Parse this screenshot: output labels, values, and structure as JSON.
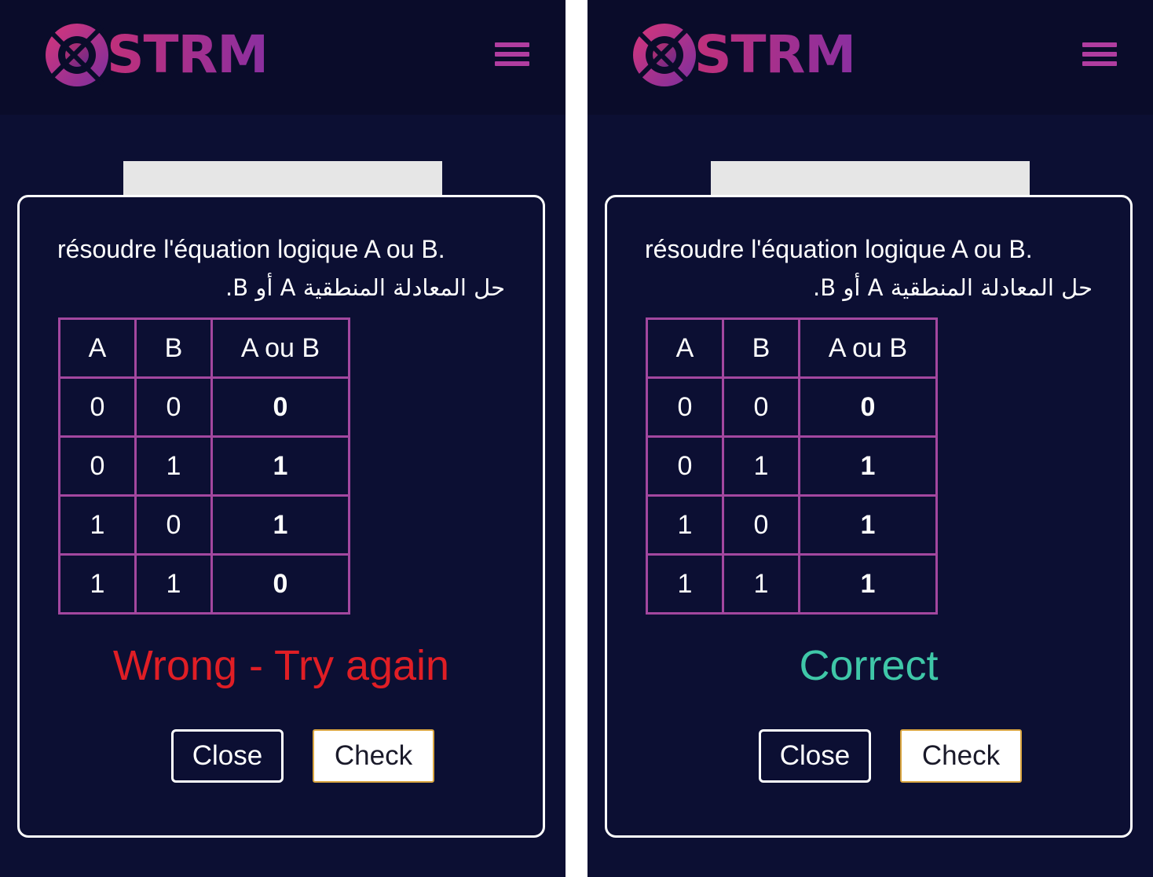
{
  "panels": [
    {
      "brand": "STRM",
      "question_fr": "résoudre l'équation logique A ou B.",
      "question_ar": "حل المعادلة المنطقية A أو B.",
      "table": {
        "headers": [
          "A",
          "B",
          "A ou B"
        ],
        "rows": [
          [
            "0",
            "0",
            "0"
          ],
          [
            "0",
            "1",
            "1"
          ],
          [
            "1",
            "0",
            "1"
          ],
          [
            "1",
            "1",
            "0"
          ]
        ]
      },
      "result": "Wrong - Try again",
      "result_color": "#e01e25",
      "close_label": "Close",
      "check_label": "Check"
    },
    {
      "brand": "STRM",
      "question_fr": "résoudre l'équation logique A ou B.",
      "question_ar": "حل المعادلة المنطقية A أو B.",
      "table": {
        "headers": [
          "A",
          "B",
          "A ou B"
        ],
        "rows": [
          [
            "0",
            "0",
            "0"
          ],
          [
            "0",
            "1",
            "1"
          ],
          [
            "1",
            "0",
            "1"
          ],
          [
            "1",
            "1",
            "1"
          ]
        ]
      },
      "result": "Correct",
      "result_color": "#3fc7a8",
      "close_label": "Close",
      "check_label": "Check"
    }
  ],
  "colors": {
    "background": "#0c0f33",
    "header": "#0a0c2a",
    "table_border": "#a3479f",
    "menu_icon": "#b03da0",
    "check_border": "#d9a541"
  },
  "icons": {
    "logo": "strm-logo-icon",
    "menu": "hamburger-menu-icon"
  }
}
